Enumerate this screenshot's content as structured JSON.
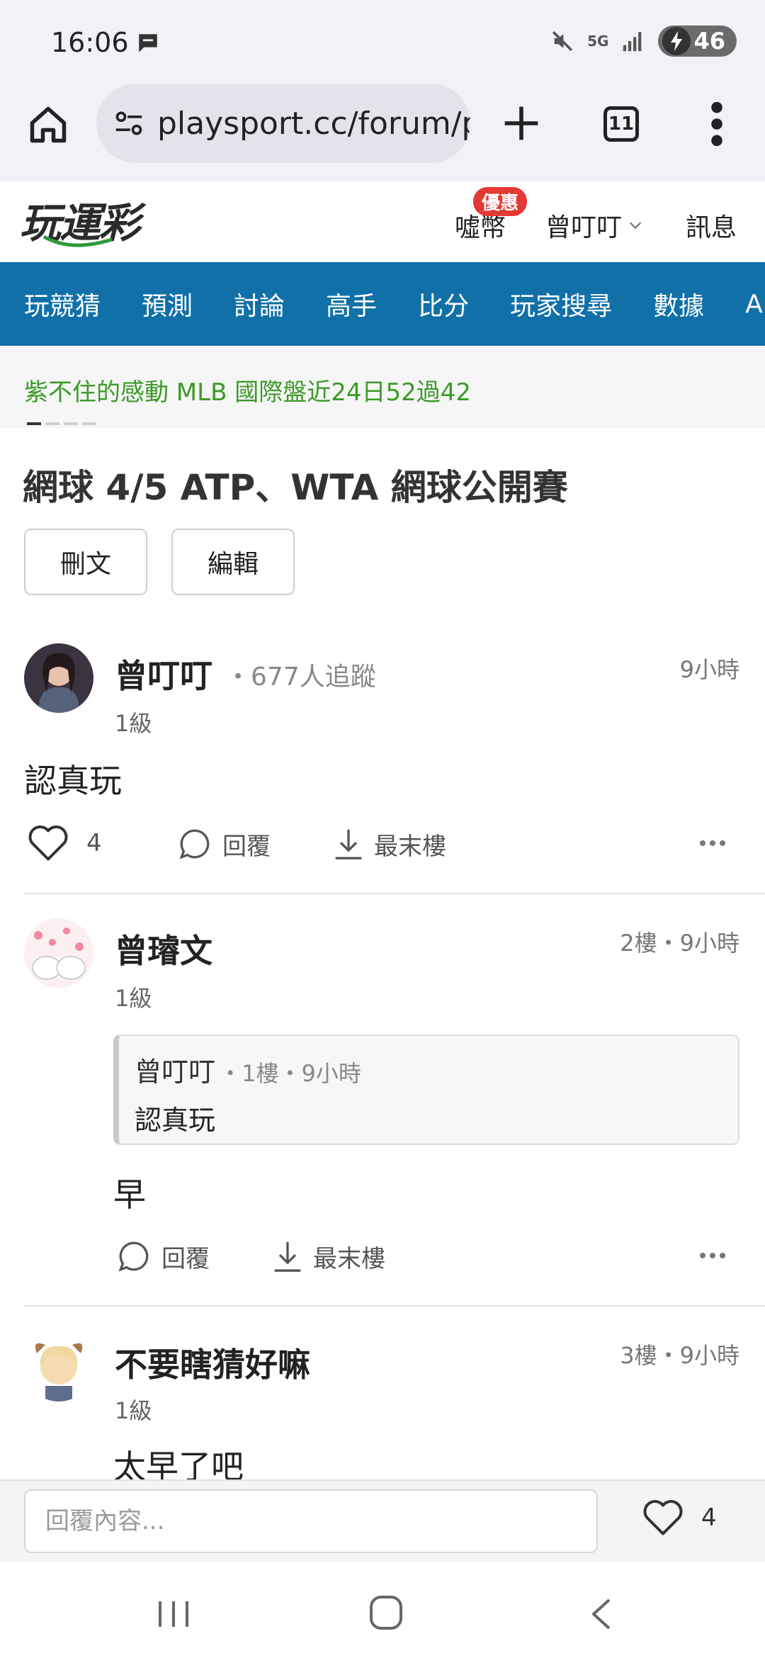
{
  "status_bar": {
    "time": "16:06",
    "network": "5G",
    "battery": "46"
  },
  "browser": {
    "url": "playsport.cc/forum/p",
    "tab_count": "11"
  },
  "site": {
    "logo": "玩運彩",
    "coin_label": "噓幣",
    "promo_badge": "優惠",
    "user_name": "曾叮叮",
    "messages_label": "訊息"
  },
  "nav": {
    "items": [
      "玩競猜",
      "預測",
      "討論",
      "高手",
      "比分",
      "玩家搜尋",
      "數據",
      "APP"
    ]
  },
  "ticker": {
    "text": "紫不住的感動 MLB 國際盤近24日52過42"
  },
  "post": {
    "title": "網球 4/5 ATP、WTA 網球公開賽",
    "delete_label": "刪文",
    "edit_label": "編輯"
  },
  "replies": [
    {
      "author": "曾叮叮",
      "followers": "677人追蹤",
      "level": "1級",
      "time": "9小時",
      "content": "認真玩",
      "like_count": "4",
      "reply_label": "回覆",
      "last_floor_label": "最末樓"
    },
    {
      "author": "曾璿文",
      "level": "1級",
      "floor_time": "2樓・9小時",
      "quote_author": "曾叮叮",
      "quote_meta": "1樓・9小時",
      "quote_content": "認真玩",
      "content": "早",
      "reply_label": "回覆",
      "last_floor_label": "最末樓"
    },
    {
      "author": "不要瞎猜好嘛",
      "level": "1級",
      "floor_time": "3樓・9小時",
      "content": "太早了吧"
    }
  ],
  "reply_bar": {
    "placeholder": "回覆內容...",
    "like_count": "4"
  },
  "colors": {
    "nav_bg": "#1170a8",
    "ticker_green": "#3c9a28",
    "promo_red": "#e53935"
  }
}
